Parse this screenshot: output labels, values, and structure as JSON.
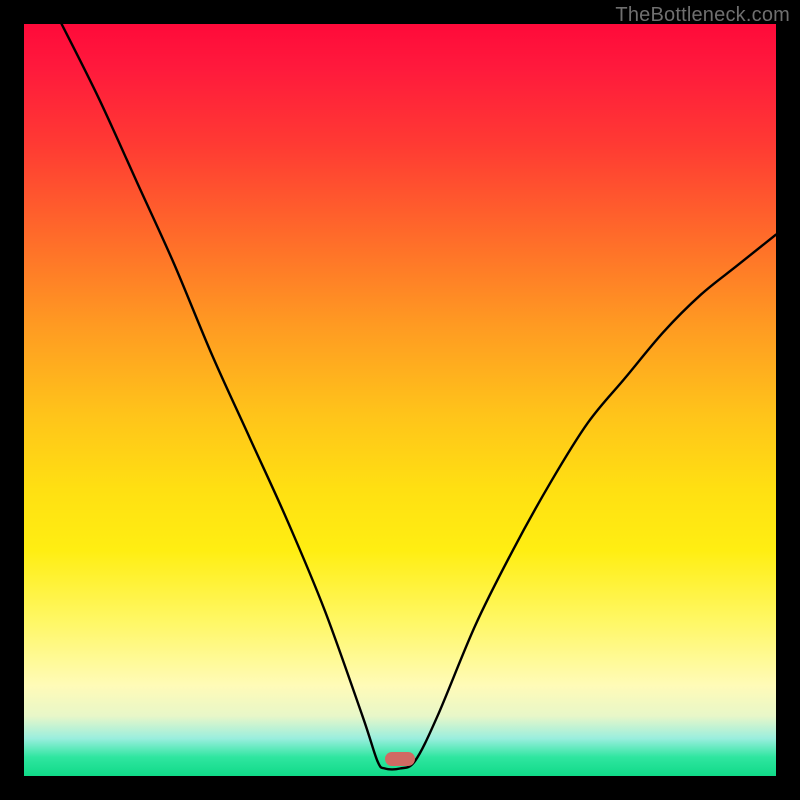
{
  "watermark": "TheBottleneck.com",
  "marker": {
    "color": "#d06a63",
    "x_percent": 48.0,
    "width_percent": 4.0,
    "bottom_percent": 1.3
  },
  "chart_data": {
    "type": "line",
    "title": "",
    "xlabel": "",
    "ylabel": "",
    "xlim": [
      0,
      100
    ],
    "ylim": [
      0,
      100
    ],
    "grid": false,
    "series": [
      {
        "name": "bottleneck-curve",
        "x": [
          5,
          10,
          15,
          20,
          25,
          30,
          35,
          40,
          45,
          47,
          48,
          50,
          52,
          55,
          60,
          65,
          70,
          75,
          80,
          85,
          90,
          95,
          100
        ],
        "values": [
          100,
          90,
          79,
          68,
          56,
          45,
          34,
          22,
          8,
          2,
          1,
          1,
          2,
          8,
          20,
          30,
          39,
          47,
          53,
          59,
          64,
          68,
          72
        ]
      }
    ],
    "annotations": [
      {
        "type": "marker",
        "x": 49,
        "label": "optimal-point"
      }
    ],
    "background": {
      "type": "vertical-gradient",
      "stops": [
        {
          "pos": 0.0,
          "color": "#ff0a3a"
        },
        {
          "pos": 0.5,
          "color": "#ffc41a"
        },
        {
          "pos": 0.8,
          "color": "#fffbb8"
        },
        {
          "pos": 0.97,
          "color": "#2fe6a0"
        },
        {
          "pos": 1.0,
          "color": "#10da88"
        }
      ]
    }
  }
}
